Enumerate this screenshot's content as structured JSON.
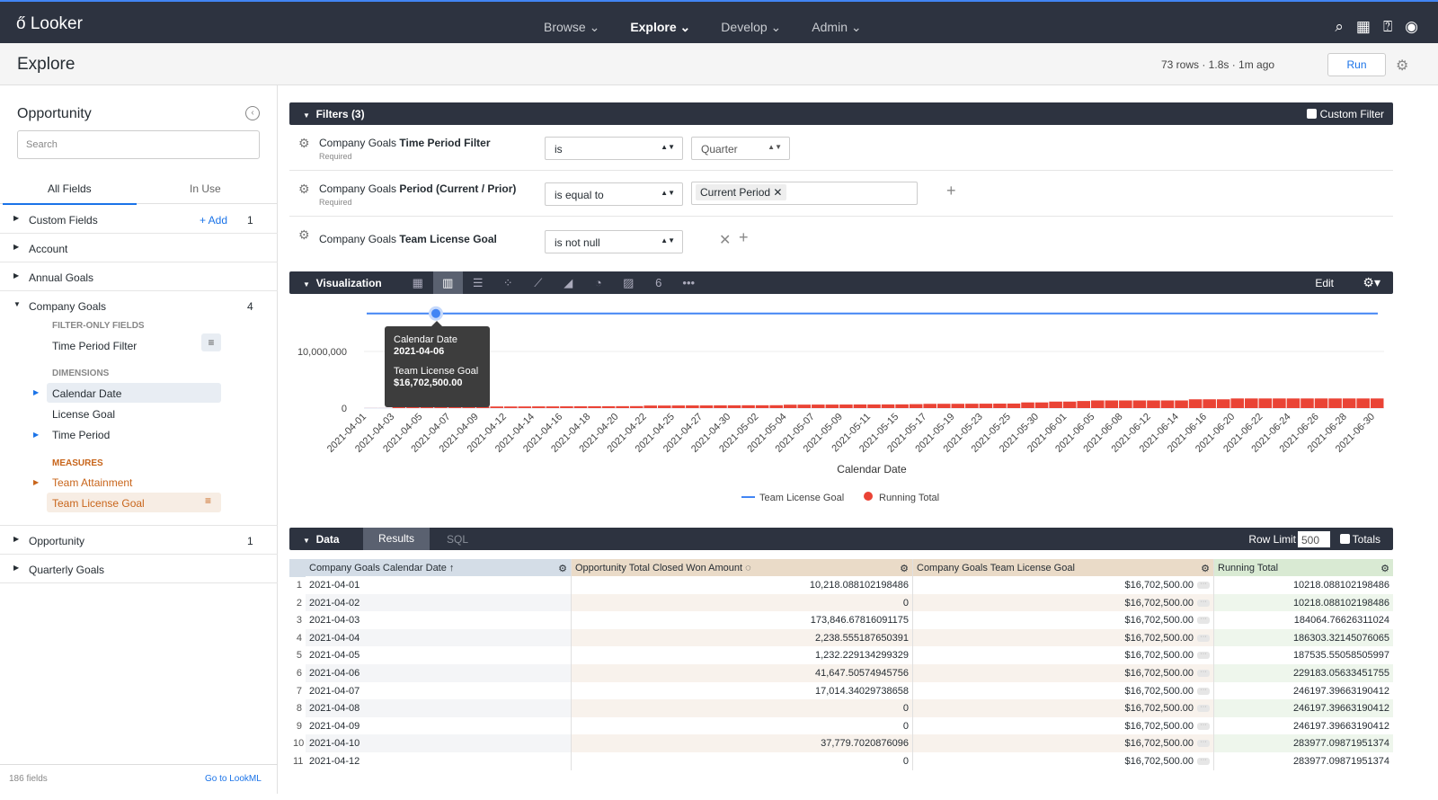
{
  "app": {
    "logo": "Looker",
    "nav": [
      "Browse",
      "Explore",
      "Develop",
      "Admin"
    ],
    "active_nav": "Explore"
  },
  "page": {
    "title": "Explore",
    "meta": "73 rows · 1.8s · 1m ago",
    "run": "Run"
  },
  "sidebar": {
    "title": "Opportunity",
    "search_placeholder": "Search",
    "tabs": [
      "All Fields",
      "In Use"
    ],
    "custom_fields": {
      "label": "Custom Fields",
      "add": "+ Add",
      "count": "1"
    },
    "account": "Account",
    "annual_goals": "Annual Goals",
    "company_goals": {
      "label": "Company Goals",
      "count": "4",
      "filter_only": "FILTER-ONLY FIELDS",
      "time_period_filter": "Time Period Filter",
      "dimensions": "DIMENSIONS",
      "calendar_date": "Calendar Date",
      "license_goal": "License Goal",
      "time_period": "Time Period",
      "measures": "MEASURES",
      "team_attainment": "Team Attainment",
      "team_license_goal": "Team License Goal"
    },
    "opportunity": {
      "label": "Opportunity",
      "count": "1"
    },
    "quarterly_goals": "Quarterly Goals",
    "footer_count": "186 fields",
    "footer_link": "Go to LookML"
  },
  "filters": {
    "title": "Filters (3)",
    "custom_filter": "Custom Filter",
    "required": "Required",
    "rows": [
      {
        "name_prefix": "Company Goals ",
        "name": "Time Period Filter",
        "op": "is",
        "value": "Quarter"
      },
      {
        "name_prefix": "Company Goals ",
        "name": "Period (Current / Prior)",
        "op": "is equal to",
        "value": "Current Period"
      },
      {
        "name_prefix": "Company Goals ",
        "name": "Team License Goal",
        "op": "is not null"
      }
    ]
  },
  "viz": {
    "title": "Visualization",
    "edit": "Edit",
    "icons": [
      "table-icon",
      "column-chart-icon",
      "bar-chart-icon",
      "scatter-icon",
      "line-chart-icon",
      "area-chart-icon",
      "pie-chart-icon",
      "map-icon",
      "single-value-icon",
      "more-icon"
    ]
  },
  "tooltip": {
    "label1": "Calendar Date",
    "value1": "2021-04-06",
    "label2": "Team License Goal",
    "value2": "$16,702,500.00"
  },
  "chart_data": {
    "type": "bar+line",
    "xlabel": "Calendar Date",
    "ylabel": "",
    "yticks": [
      "0",
      "10,000,000"
    ],
    "ylim": [
      0,
      17500000
    ],
    "legend_placement": "bottom",
    "x_tick_labels": [
      "2021-04-01",
      "2021-04-03",
      "2021-04-05",
      "2021-04-07",
      "2021-04-09",
      "2021-04-12",
      "2021-04-14",
      "2021-04-16",
      "2021-04-18",
      "2021-04-20",
      "2021-04-22",
      "2021-04-25",
      "2021-04-27",
      "2021-04-30",
      "2021-05-02",
      "2021-05-04",
      "2021-05-07",
      "2021-05-09",
      "2021-05-11",
      "2021-05-15",
      "2021-05-17",
      "2021-05-19",
      "2021-05-23",
      "2021-05-25",
      "2021-05-30",
      "2021-06-01",
      "2021-06-05",
      "2021-06-08",
      "2021-06-12",
      "2021-06-14",
      "2021-06-16",
      "2021-06-20",
      "2021-06-22",
      "2021-06-24",
      "2021-06-26",
      "2021-06-28",
      "2021-06-30"
    ],
    "series": [
      {
        "name": "Team License Goal",
        "type": "line",
        "color": "#4285f4",
        "value": 16702500
      },
      {
        "name": "Running Total",
        "type": "bar",
        "color": "#ea4335",
        "values": [
          10218,
          10218,
          184065,
          186303,
          187536,
          229183,
          246197,
          246197,
          246197,
          283977,
          283977,
          290000,
          300000,
          300000,
          310000,
          320000,
          330000,
          330000,
          340000,
          350000,
          450000,
          450000,
          460000,
          470000,
          470000,
          480000,
          490000,
          500000,
          500000,
          510000,
          600000,
          610000,
          620000,
          620000,
          630000,
          640000,
          640000,
          650000,
          660000,
          700000,
          750000,
          760000,
          760000,
          770000,
          780000,
          790000,
          800000,
          1000000,
          1000000,
          1150000,
          1150000,
          1250000,
          1350000,
          1350000,
          1350000,
          1350000,
          1350000,
          1350000,
          1350000,
          1550000,
          1550000,
          1550000,
          1700000,
          1700000,
          1700000,
          1700000,
          1700000,
          1700000,
          1700000,
          1700000,
          1700000,
          1700000,
          1700000
        ]
      }
    ]
  },
  "data": {
    "title": "Data",
    "tabs": [
      "Results",
      "SQL"
    ],
    "row_limit_label": "Row Limit",
    "row_limit": "500",
    "totals": "Totals",
    "columns": [
      "Company Goals Calendar Date ↑",
      "Opportunity Total Closed Won Amount",
      "Company Goals Team License Goal",
      "Running Total"
    ],
    "rows": [
      [
        "1",
        "2021-04-01",
        "10,218.088102198486",
        "$16,702,500.00",
        "10218.088102198486"
      ],
      [
        "2",
        "2021-04-02",
        "0",
        "$16,702,500.00",
        "10218.088102198486"
      ],
      [
        "3",
        "2021-04-03",
        "173,846.67816091175",
        "$16,702,500.00",
        "184064.76626311024"
      ],
      [
        "4",
        "2021-04-04",
        "2,238.555187650391",
        "$16,702,500.00",
        "186303.32145076065"
      ],
      [
        "5",
        "2021-04-05",
        "1,232.229134299329",
        "$16,702,500.00",
        "187535.55058505997"
      ],
      [
        "6",
        "2021-04-06",
        "41,647.50574945756",
        "$16,702,500.00",
        "229183.05633451755"
      ],
      [
        "7",
        "2021-04-07",
        "17,014.34029738658",
        "$16,702,500.00",
        "246197.39663190412"
      ],
      [
        "8",
        "2021-04-08",
        "0",
        "$16,702,500.00",
        "246197.39663190412"
      ],
      [
        "9",
        "2021-04-09",
        "0",
        "$16,702,500.00",
        "246197.39663190412"
      ],
      [
        "10",
        "2021-04-10",
        "37,779.7020876096",
        "$16,702,500.00",
        "283977.09871951374"
      ],
      [
        "11",
        "2021-04-12",
        "0",
        "$16,702,500.00",
        "283977.09871951374"
      ]
    ]
  },
  "colors": {
    "topbar": "#2d3340",
    "accent": "#1a73e8",
    "dimension_header": "#d4dde7",
    "measure_header": "#eadbc8",
    "calc_header": "#d9ead3",
    "measure_text": "#c8651b"
  }
}
